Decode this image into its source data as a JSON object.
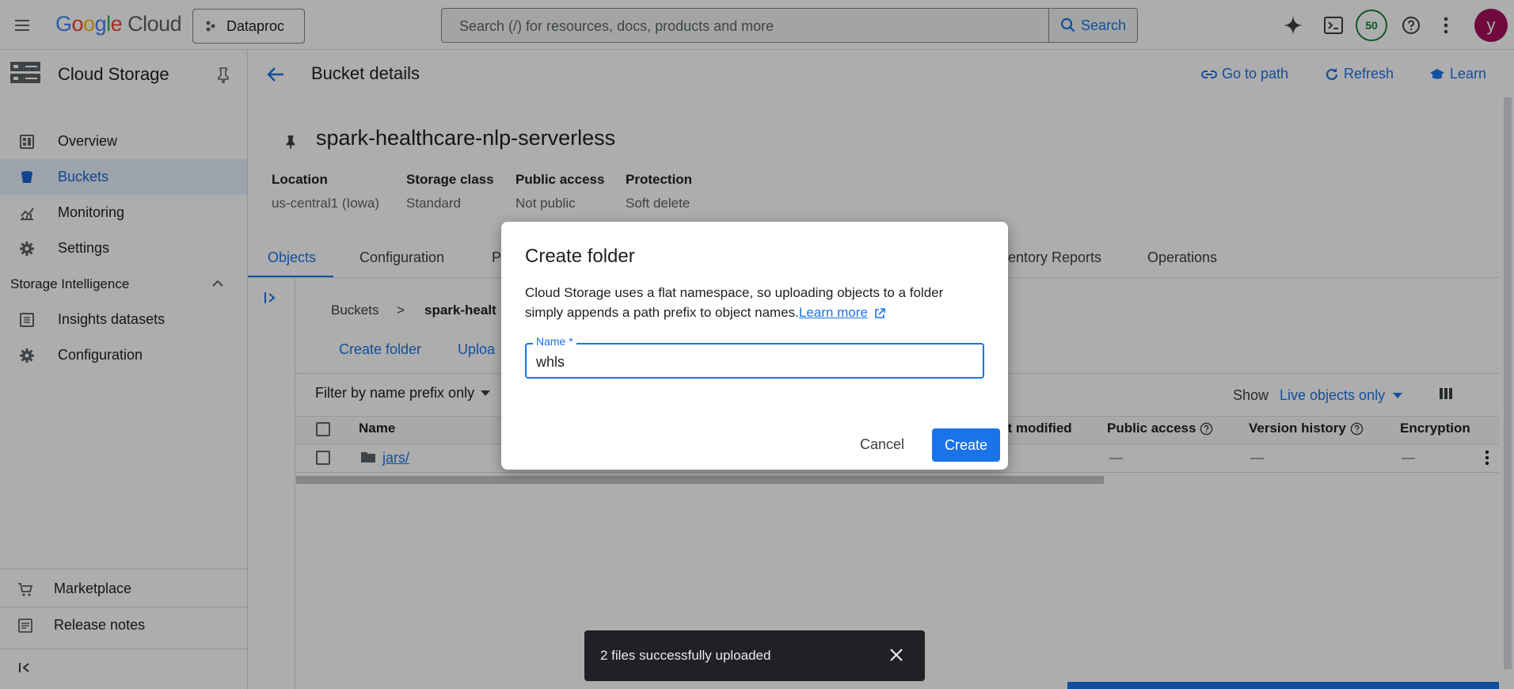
{
  "topbar": {
    "brand": "Google Cloud",
    "project": "Dataproc",
    "search_placeholder": "Search (/) for resources, docs, products and more",
    "search_button": "Search",
    "notification_count": "50",
    "avatar_letter": "y"
  },
  "sidebar": {
    "title": "Cloud Storage",
    "items": [
      {
        "label": "Overview"
      },
      {
        "label": "Buckets"
      },
      {
        "label": "Monitoring"
      },
      {
        "label": "Settings"
      }
    ],
    "section": "Storage Intelligence",
    "section_items": [
      {
        "label": "Insights datasets"
      },
      {
        "label": "Configuration"
      }
    ],
    "footer_items": [
      {
        "label": "Marketplace"
      },
      {
        "label": "Release notes"
      }
    ]
  },
  "header": {
    "title": "Bucket details",
    "go_to_path": "Go to path",
    "refresh": "Refresh",
    "learn": "Learn"
  },
  "bucket": {
    "name": "spark-healthcare-nlp-serverless",
    "props": [
      {
        "label": "Location",
        "value": "us-central1 (Iowa)"
      },
      {
        "label": "Storage class",
        "value": "Standard"
      },
      {
        "label": "Public access",
        "value": "Not public"
      },
      {
        "label": "Protection",
        "value": "Soft delete"
      }
    ]
  },
  "tabs": {
    "objects": "Objects",
    "configuration": "Configuration",
    "permissions": "Pe",
    "inventory": "entory Reports",
    "operations": "Operations"
  },
  "browser": {
    "crumb_root": "Buckets",
    "crumb_current": "spark-healt",
    "create_folder": "Create folder",
    "upload": "Uploa",
    "filter": "Filter by name prefix only",
    "show_label": "Show",
    "show_value": "Live objects only",
    "columns": {
      "name": "Name",
      "last_modified": "st modified",
      "public_access": "Public access",
      "version_history": "Version history",
      "encryption": "Encryption"
    },
    "rows": [
      {
        "name": "jars/",
        "public_access": "—",
        "version_history": "—",
        "encryption": "—"
      }
    ]
  },
  "dialog": {
    "title": "Create folder",
    "description": "Cloud Storage uses a flat namespace, so uploading objects to a folder simply appends a path prefix to object names.",
    "learn_more": "Learn more",
    "field_label": "Name *",
    "field_value": "whls",
    "cancel": "Cancel",
    "create": "Create"
  },
  "snackbar": {
    "message": "2 files successfully uploaded"
  },
  "colors": {
    "accent": "#1a73e8",
    "active_nav_bg": "#e8f0fe",
    "notification_ring": "#188038",
    "avatar_bg": "#a50e5a"
  }
}
